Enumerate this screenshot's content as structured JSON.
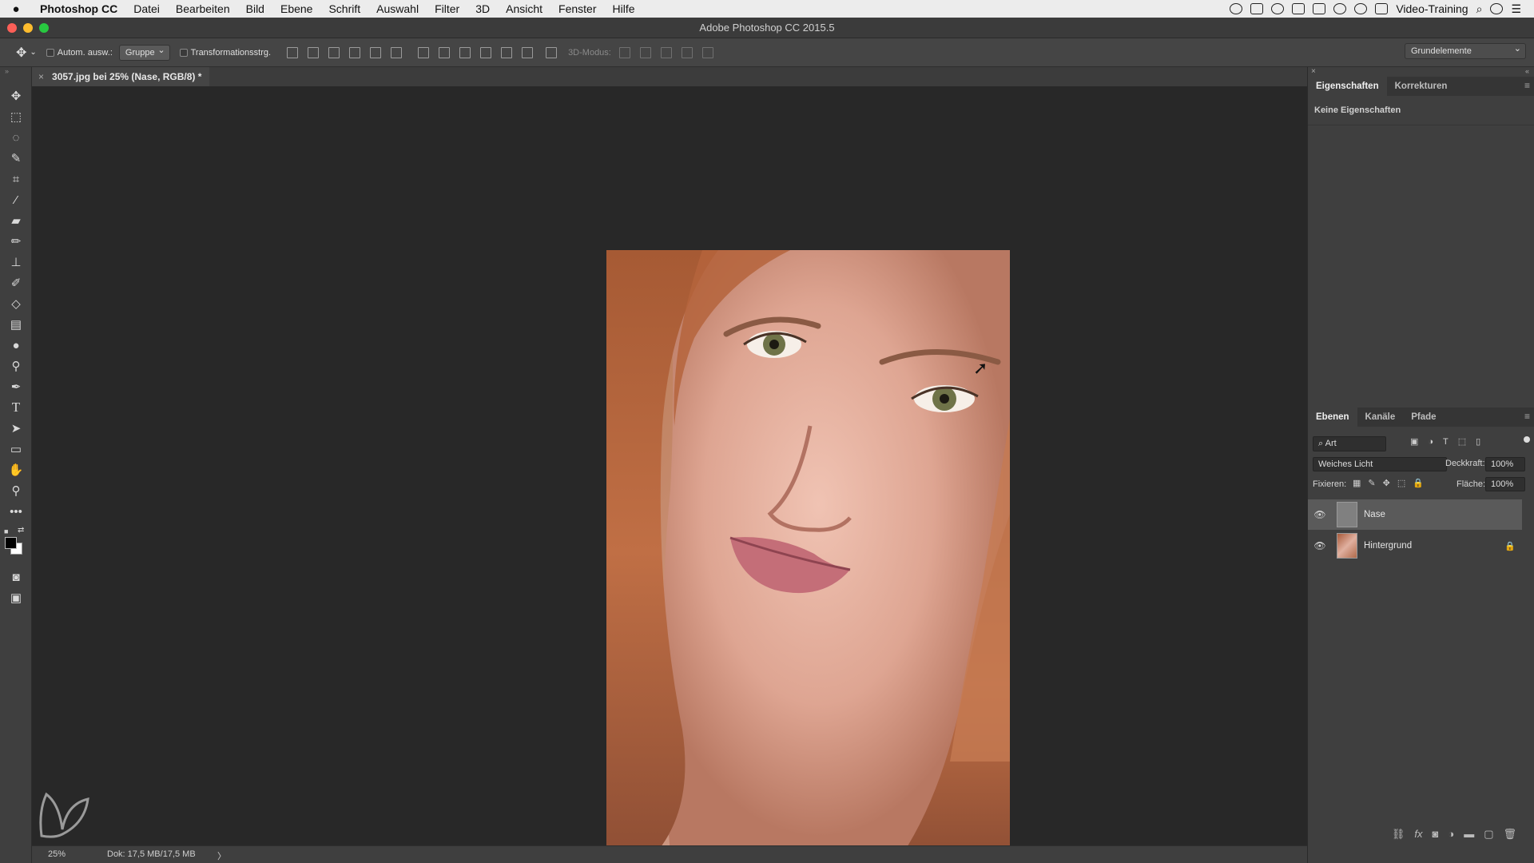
{
  "menubar": {
    "apple": "",
    "app_name": "Photoshop CC",
    "items": [
      "Datei",
      "Bearbeiten",
      "Bild",
      "Ebene",
      "Schrift",
      "Auswahl",
      "Filter",
      "3D",
      "Ansicht",
      "Fenster",
      "Hilfe"
    ],
    "user": "Video-Training"
  },
  "titlebar": {
    "title": "Adobe Photoshop CC 2015.5"
  },
  "options": {
    "auto_select_label": "Autom. ausw.:",
    "auto_select_value": "Gruppe",
    "transform_label": "Transformationsstrg.",
    "mode_3d": "3D-Modus:",
    "workspace": "Grundelemente"
  },
  "document": {
    "tab_close": "×",
    "tab_title": "3057.jpg bei 25% (Nase, RGB/8) *"
  },
  "status": {
    "zoom": "25%",
    "doc_size": "Dok: 17,5 MB/17,5 MB",
    "arrow": "〉"
  },
  "properties_panel": {
    "tabs": [
      "Eigenschaften",
      "Korrekturen"
    ],
    "message": "Keine Eigenschaften"
  },
  "layers_panel": {
    "tabs": [
      "Ebenen",
      "Kanäle",
      "Pfade"
    ],
    "filter": "Art",
    "blend_mode": "Weiches Licht",
    "opacity_label": "Deckkraft:",
    "opacity_value": "100%",
    "lock_label": "Fixieren:",
    "fill_label": "Fläche:",
    "fill_value": "100%",
    "layers": [
      {
        "name": "Nase",
        "visible": true,
        "selected": true,
        "locked": false
      },
      {
        "name": "Hintergrund",
        "visible": true,
        "selected": false,
        "locked": true
      }
    ]
  },
  "colors": {
    "accent_menu": "#ececec",
    "panel_bg": "#3f3f3f",
    "canvas_bg": "#282828"
  }
}
